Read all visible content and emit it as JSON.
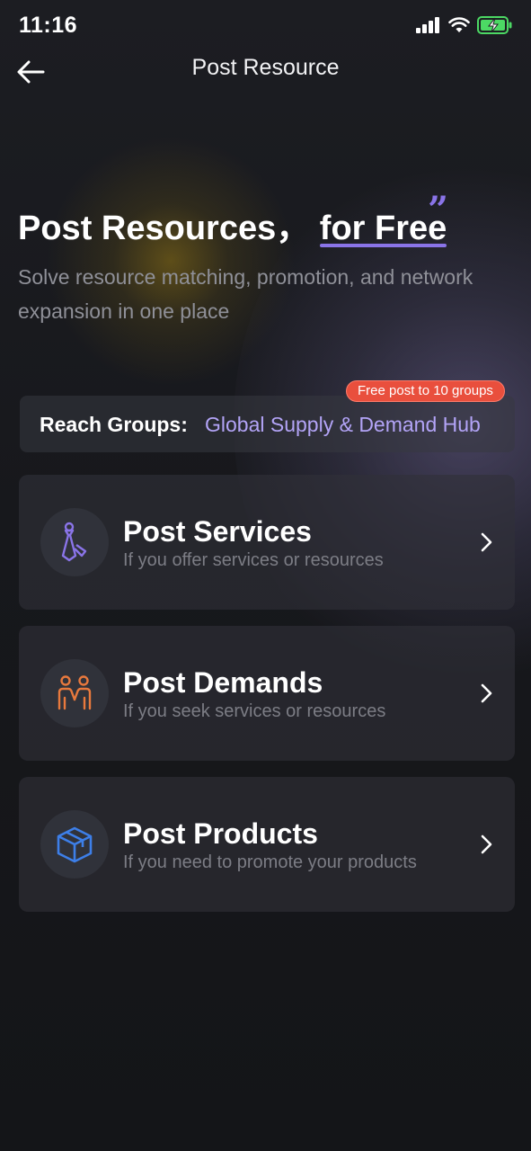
{
  "status": {
    "time": "11:16"
  },
  "nav": {
    "title": "Post Resource"
  },
  "hero": {
    "title_main": "Post Resources，",
    "title_highlight": "for Free",
    "quote": "”",
    "subtitle": "Solve resource matching, promotion, and network expansion in one place"
  },
  "reach": {
    "label": "Reach Groups:",
    "value": "Global Supply & Demand Hub",
    "badge": "Free post to 10 groups"
  },
  "cards": [
    {
      "title": "Post Services",
      "subtitle": "If you offer services or resources",
      "icon": "tie-icon",
      "icon_color": "#8a74e8"
    },
    {
      "title": "Post Demands",
      "subtitle": "If you seek services or resources",
      "icon": "people-icon",
      "icon_color": "#e8793d"
    },
    {
      "title": "Post Products",
      "subtitle": "If you need to promote your products",
      "icon": "box-icon",
      "icon_color": "#3d7fe8"
    }
  ]
}
